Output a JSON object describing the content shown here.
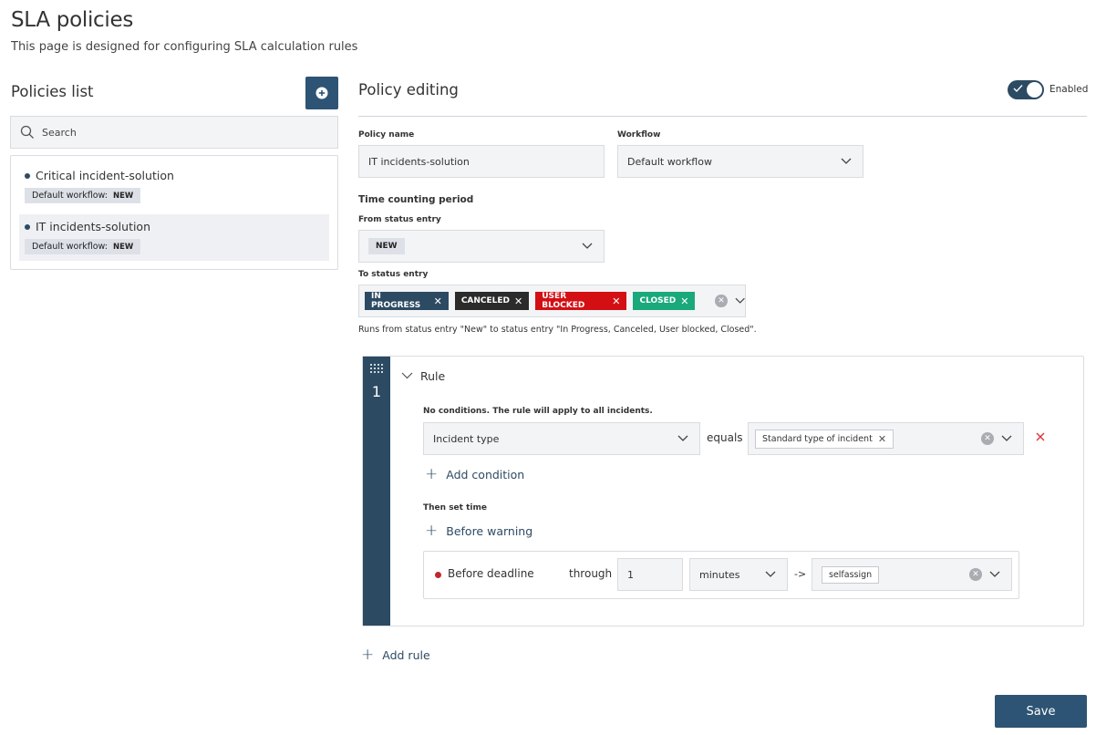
{
  "header": {
    "title": "SLA policies",
    "subtitle": "This page is designed for configuring SLA calculation rules"
  },
  "policies": {
    "title": "Policies list",
    "add_icon": "plus-circle-icon",
    "search": {
      "placeholder": "Search",
      "value": ""
    },
    "items": [
      {
        "name": "Critical incident-solution",
        "workflow_label": "Default workflow:",
        "status": "NEW",
        "selected": false
      },
      {
        "name": "IT incidents-solution",
        "workflow_label": "Default workflow:",
        "status": "NEW",
        "selected": true
      }
    ]
  },
  "editor": {
    "title": "Policy editing",
    "enabled_label": "Enabled",
    "enabled": true,
    "policy_name_label": "Policy name",
    "policy_name_value": "IT incidents-solution",
    "workflow_label": "Workflow",
    "workflow_value": "Default workflow",
    "time_period_title": "Time counting period",
    "from_label": "From status entry",
    "from_value": "NEW",
    "to_label": "To status entry",
    "to_tags": [
      {
        "label": "IN PROGRESS",
        "color": "#2d4a63"
      },
      {
        "label": "CANCELED",
        "color": "#2b2b2b"
      },
      {
        "label": "USER BLOCKED",
        "color": "#d40f14"
      },
      {
        "label": "CLOSED",
        "color": "#1aa97a"
      }
    ],
    "runs_note": "Runs from status entry \"New\" to status entry \"In Progress, Canceled, User blocked, Closed\"."
  },
  "rule": {
    "number": "1",
    "title": "Rule",
    "no_conditions": "No conditions. The rule will apply to all incidents.",
    "condition_field": "Incident type",
    "condition_operator": "equals",
    "condition_value": "Standard type of incident",
    "add_condition": "Add condition",
    "then_set_time": "Then set time",
    "before_warning": "Before warning",
    "deadline": {
      "label": "Before deadline",
      "through": "through",
      "amount": "1",
      "units": "minutes",
      "arrow": "->",
      "action": "selfassign"
    }
  },
  "footer": {
    "add_rule": "Add rule",
    "save": "Save"
  },
  "colors": {
    "primary": "#2d5474",
    "deadline_dot": "#c0282d",
    "delete_x": "#d9383a"
  }
}
